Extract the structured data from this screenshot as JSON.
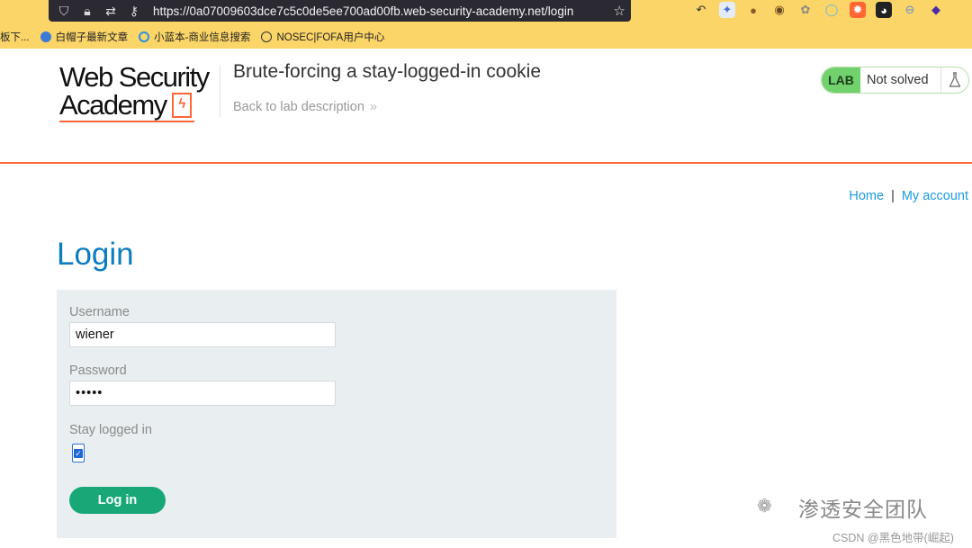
{
  "browser": {
    "url": "https://0a07009603dce7c5c0de5ee700ad00fb.web-security-academy.net/login",
    "bookmarks": [
      "板下...",
      "白帽子最新文章",
      "小蓝本-商业信息搜索",
      "NOSEC|FOFA用户中心"
    ]
  },
  "header": {
    "logo_line1": "Web Security",
    "logo_line2": "Academy",
    "lab_title": "Brute-forcing a stay-logged-in cookie",
    "back_link": "Back to lab description",
    "lab_badge": "LAB",
    "lab_status": "Not solved"
  },
  "nav": {
    "home": "Home",
    "separator": "|",
    "my_account": "My account"
  },
  "login": {
    "title": "Login",
    "username_label": "Username",
    "username_value": "wiener",
    "password_label": "Password",
    "password_value": "•••••",
    "stay_logged_label": "Stay logged in",
    "stay_logged_checked": true,
    "button_label": "Log in"
  },
  "watermark": {
    "main": "渗透安全团队",
    "csdn": "CSDN @黑色地带(崛起)"
  },
  "colors": {
    "accent_orange": "#ff6633",
    "link_blue": "#1a9be0",
    "button_green": "#18a878",
    "lab_badge_green": "#70d16d",
    "browser_bar": "#fbd567"
  }
}
